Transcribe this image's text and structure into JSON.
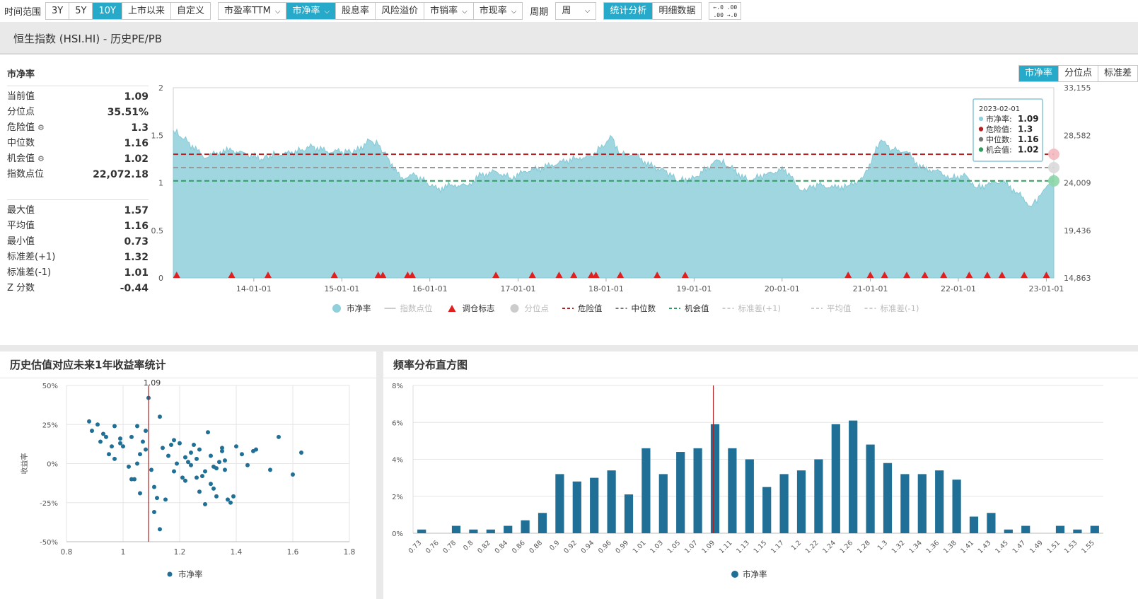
{
  "toolbar": {
    "range_label": "时间范围",
    "range_buttons": [
      "3Y",
      "5Y",
      "10Y",
      "上市以来",
      "自定义"
    ],
    "metric_buttons": [
      "市盈率TTM",
      "市净率",
      "股息率",
      "风险溢价",
      "市销率",
      "市现率"
    ],
    "period_label": "周期",
    "period_value": "周",
    "mode_buttons": [
      "统计分析",
      "明细数据"
    ],
    "decimal_icon_top": "←.0 .00",
    "decimal_icon_bottom": ".00 →.0"
  },
  "title": "恒生指数 (HSI.HI) - 历史PE/PB",
  "stats": {
    "title": "市净率",
    "rows1": [
      {
        "label": "当前值",
        "value": "1.09"
      },
      {
        "label": "分位点",
        "value": "35.51%"
      },
      {
        "label": "危险值",
        "value": "1.3",
        "gear": true
      },
      {
        "label": "中位数",
        "value": "1.16"
      },
      {
        "label": "机会值",
        "value": "1.02",
        "gear": true
      },
      {
        "label": "指数点位",
        "value": "22,072.18"
      }
    ],
    "rows2": [
      {
        "label": "最大值",
        "value": "1.57"
      },
      {
        "label": "平均值",
        "value": "1.16"
      },
      {
        "label": "最小值",
        "value": "0.73"
      },
      {
        "label": "标准差(+1)",
        "value": "1.32"
      },
      {
        "label": "标准差(-1)",
        "value": "1.01"
      },
      {
        "label": "Z 分数",
        "value": "-0.44"
      }
    ]
  },
  "right_tabs": [
    "市净率",
    "分位点",
    "标准差"
  ],
  "tooltip": {
    "date": "2023-02-01",
    "rows": [
      {
        "label": "市净率: ",
        "value": "1.09",
        "color": "#8fd0dc"
      },
      {
        "label": "危险值: ",
        "value": "1.3",
        "color": "#b22222"
      },
      {
        "label": "中位数: ",
        "value": "1.16",
        "color": "#777777"
      },
      {
        "label": "机会值: ",
        "value": "1.02",
        "color": "#2e9e5e"
      }
    ]
  },
  "colors": {
    "accent": "#27a9c9",
    "area": "#9fd6e0",
    "danger": "#b22222",
    "median": "#999999",
    "opportunity": "#2e9e5e",
    "marker": "#e02020",
    "bar": "#1f6f96"
  },
  "chart_data": [
    {
      "type": "area",
      "series_name": "市净率",
      "left_axis": {
        "ticks": [
          "0",
          "0.5",
          "1",
          "1.5",
          "2"
        ],
        "range": [
          0,
          2
        ]
      },
      "right_axis": {
        "ticks": [
          "14,863",
          "19,436",
          "24,009",
          "28,582",
          "33,155"
        ]
      },
      "x_ticks": [
        "14-01-01",
        "15-01-01",
        "16-01-01",
        "17-01-01",
        "18-01-01",
        "19-01-01",
        "20-01-01",
        "21-01-01",
        "22-01-01",
        "23-01-01"
      ],
      "x_range": [
        "2013-02-01",
        "2023-02-01"
      ],
      "pb_weekly_approx": [
        [
          "2013-02-01",
          1.55
        ],
        [
          "2013-04-01",
          1.43
        ],
        [
          "2013-06-15",
          1.26
        ],
        [
          "2013-08-01",
          1.32
        ],
        [
          "2013-10-01",
          1.34
        ],
        [
          "2013-12-01",
          1.3
        ],
        [
          "2014-02-01",
          1.25
        ],
        [
          "2014-04-01",
          1.3
        ],
        [
          "2014-06-01",
          1.31
        ],
        [
          "2014-09-01",
          1.38
        ],
        [
          "2014-11-01",
          1.33
        ],
        [
          "2015-01-01",
          1.33
        ],
        [
          "2015-03-01",
          1.33
        ],
        [
          "2015-04-25",
          1.45
        ],
        [
          "2015-06-01",
          1.4
        ],
        [
          "2015-07-15",
          1.25
        ],
        [
          "2015-09-01",
          1.05
        ],
        [
          "2015-11-01",
          1.08
        ],
        [
          "2016-02-01",
          0.93
        ],
        [
          "2016-04-01",
          0.98
        ],
        [
          "2016-06-01",
          0.97
        ],
        [
          "2016-08-01",
          1.08
        ],
        [
          "2016-10-01",
          1.12
        ],
        [
          "2016-12-01",
          1.05
        ],
        [
          "2017-02-01",
          1.12
        ],
        [
          "2017-05-01",
          1.17
        ],
        [
          "2017-07-01",
          1.22
        ],
        [
          "2017-09-01",
          1.26
        ],
        [
          "2017-11-01",
          1.28
        ],
        [
          "2018-01-26",
          1.48
        ],
        [
          "2018-03-01",
          1.3
        ],
        [
          "2018-05-01",
          1.3
        ],
        [
          "2018-07-01",
          1.18
        ],
        [
          "2018-09-01",
          1.13
        ],
        [
          "2018-10-30",
          1.02
        ],
        [
          "2019-01-01",
          1.05
        ],
        [
          "2019-04-10",
          1.24
        ],
        [
          "2019-06-01",
          1.16
        ],
        [
          "2019-08-15",
          1.02
        ],
        [
          "2019-11-01",
          1.1
        ],
        [
          "2020-01-15",
          1.14
        ],
        [
          "2020-03-20",
          0.92
        ],
        [
          "2020-06-01",
          0.98
        ],
        [
          "2020-08-01",
          0.95
        ],
        [
          "2020-10-01",
          0.97
        ],
        [
          "2020-12-01",
          1.05
        ],
        [
          "2021-02-15",
          1.45
        ],
        [
          "2021-04-01",
          1.35
        ],
        [
          "2021-06-01",
          1.33
        ],
        [
          "2021-08-01",
          1.15
        ],
        [
          "2021-10-01",
          1.13
        ],
        [
          "2021-12-01",
          1.05
        ],
        [
          "2022-02-01",
          1.08
        ],
        [
          "2022-03-15",
          0.95
        ],
        [
          "2022-05-01",
          0.98
        ],
        [
          "2022-07-01",
          1.02
        ],
        [
          "2022-09-01",
          0.9
        ],
        [
          "2022-10-31",
          0.75
        ],
        [
          "2022-12-15",
          0.9
        ],
        [
          "2023-02-01",
          1.09
        ]
      ],
      "danger_value": 1.3,
      "median_value": 1.16,
      "opportunity_value": 1.02,
      "rebalance_markers": [
        "2013-02-15",
        "2013-10-01",
        "2014-03-01",
        "2014-12-01",
        "2015-06-01",
        "2015-06-20",
        "2015-10-01",
        "2015-10-20",
        "2016-10-01",
        "2017-03-01",
        "2017-06-20",
        "2017-08-20",
        "2017-11-01",
        "2017-11-20",
        "2018-03-01",
        "2018-08-01",
        "2018-11-25",
        "2020-10-01",
        "2021-01-01",
        "2021-03-01",
        "2021-06-01",
        "2021-08-15",
        "2021-11-01",
        "2022-02-15",
        "2022-05-01",
        "2022-07-01",
        "2022-10-01",
        "2023-01-01"
      ],
      "legend": [
        {
          "label": "市净率",
          "kind": "dot",
          "color": "#8fd0dc",
          "active": true
        },
        {
          "label": "指数点位",
          "kind": "line",
          "color": "#cccccc",
          "active": false
        },
        {
          "label": "调仓标志",
          "kind": "triangle",
          "color": "#e02020",
          "active": true
        },
        {
          "label": "分位点",
          "kind": "dot",
          "color": "#cccccc",
          "active": false
        },
        {
          "label": "危险值",
          "kind": "dash",
          "color": "#b22222",
          "active": true
        },
        {
          "label": "中位数",
          "kind": "dash",
          "color": "#777777",
          "active": true
        },
        {
          "label": "机会值",
          "kind": "dash",
          "color": "#2e9e5e",
          "active": true
        },
        {
          "label": "标准差(+1)",
          "kind": "dash",
          "color": "#cccccc",
          "active": false
        },
        {
          "label": "平均值",
          "kind": "dash",
          "color": "#cccccc",
          "active": false
        },
        {
          "label": "标准差(-1)",
          "kind": "dash",
          "color": "#cccccc",
          "active": false
        }
      ]
    },
    {
      "type": "scatter",
      "title": "历史估值对应未来1年收益率统计",
      "ylabel": "收益率",
      "legend": "市净率",
      "x_ticks": [
        "0.8",
        "1",
        "1.2",
        "1.4",
        "1.6",
        "1.8"
      ],
      "xlim": [
        0.8,
        1.8
      ],
      "y_ticks": [
        "-50%",
        "-25%",
        "0%",
        "25%",
        "50%"
      ],
      "ylim": [
        -50,
        50
      ],
      "current_marker": "1.09",
      "current_value": 1.09,
      "points": [
        [
          0.88,
          27
        ],
        [
          0.89,
          21
        ],
        [
          0.91,
          25
        ],
        [
          0.93,
          19
        ],
        [
          0.94,
          17
        ],
        [
          0.95,
          6
        ],
        [
          0.97,
          3
        ],
        [
          0.97,
          24
        ],
        [
          0.99,
          16
        ],
        [
          1.0,
          11
        ],
        [
          1.02,
          -2
        ],
        [
          1.03,
          -10
        ],
        [
          1.04,
          -10
        ],
        [
          1.05,
          0
        ],
        [
          1.05,
          24
        ],
        [
          1.06,
          6
        ],
        [
          1.07,
          14
        ],
        [
          1.08,
          9
        ],
        [
          1.09,
          42
        ],
        [
          1.1,
          -4
        ],
        [
          1.11,
          -15
        ],
        [
          1.12,
          -22
        ],
        [
          1.13,
          30
        ],
        [
          1.14,
          10
        ],
        [
          1.16,
          5
        ],
        [
          1.18,
          -5
        ],
        [
          1.19,
          0
        ],
        [
          1.2,
          13
        ],
        [
          1.22,
          -11
        ],
        [
          1.24,
          7
        ],
        [
          1.26,
          3
        ],
        [
          1.28,
          -8
        ],
        [
          1.3,
          20
        ],
        [
          1.31,
          -13
        ],
        [
          1.32,
          -2
        ],
        [
          1.33,
          -3
        ],
        [
          1.34,
          1
        ],
        [
          1.35,
          10
        ],
        [
          1.36,
          -4
        ],
        [
          1.38,
          -25
        ],
        [
          1.4,
          11
        ],
        [
          1.42,
          6
        ],
        [
          1.44,
          -1
        ],
        [
          1.46,
          8
        ],
        [
          1.47,
          9
        ],
        [
          1.52,
          -4
        ],
        [
          1.55,
          17
        ],
        [
          1.6,
          -7
        ],
        [
          1.63,
          7
        ],
        [
          0.92,
          14
        ],
        [
          0.96,
          11
        ],
        [
          0.99,
          13
        ],
        [
          1.03,
          17
        ],
        [
          1.06,
          -19
        ],
        [
          1.08,
          21
        ],
        [
          1.11,
          -31
        ],
        [
          1.15,
          -23
        ],
        [
          1.18,
          15
        ],
        [
          1.21,
          -9
        ],
        [
          1.25,
          12
        ],
        [
          1.27,
          -18
        ],
        [
          1.29,
          -26
        ],
        [
          1.31,
          5
        ],
        [
          1.33,
          -21
        ],
        [
          1.36,
          2
        ],
        [
          1.39,
          -21
        ],
        [
          1.23,
          1
        ],
        [
          1.17,
          12
        ],
        [
          1.13,
          -42
        ],
        [
          1.22,
          4
        ],
        [
          1.27,
          9
        ],
        [
          1.24,
          -1
        ],
        [
          1.29,
          -5
        ],
        [
          1.32,
          -16
        ],
        [
          1.35,
          8
        ],
        [
          1.37,
          -23
        ],
        [
          1.26,
          -9
        ]
      ]
    },
    {
      "type": "bar",
      "title": "频率分布直方图",
      "legend": "市净率",
      "y_ticks": [
        "0%",
        "2%",
        "4%",
        "6%",
        "8%"
      ],
      "ylim": [
        0,
        8
      ],
      "current_index": 15,
      "categories": [
        "0.73",
        "0.76",
        "0.78",
        "0.8",
        "0.82",
        "0.84",
        "0.86",
        "0.88",
        "0.9",
        "0.92",
        "0.94",
        "0.96",
        "0.99",
        "1.01",
        "1.03",
        "1.05",
        "1.07",
        "1.09",
        "1.11",
        "1.13",
        "1.15",
        "1.17",
        "1.2",
        "1.22",
        "1.24",
        "1.26",
        "1.28",
        "1.3",
        "1.32",
        "1.34",
        "1.36",
        "1.38",
        "1.41",
        "1.43",
        "1.45",
        "1.47",
        "1.49",
        "1.51",
        "1.53",
        "1.55"
      ],
      "values": [
        0.2,
        0.0,
        0.4,
        0.2,
        0.2,
        0.4,
        0.7,
        1.1,
        3.2,
        2.8,
        3.0,
        3.4,
        2.1,
        4.6,
        3.2,
        4.4,
        4.6,
        5.9,
        4.6,
        4.0,
        2.5,
        3.2,
        3.4,
        4.0,
        5.9,
        6.1,
        4.8,
        3.8,
        3.2,
        3.2,
        3.4,
        2.9,
        0.9,
        1.1,
        0.2,
        0.4,
        0.0,
        0.4,
        0.2,
        0.4
      ]
    }
  ]
}
